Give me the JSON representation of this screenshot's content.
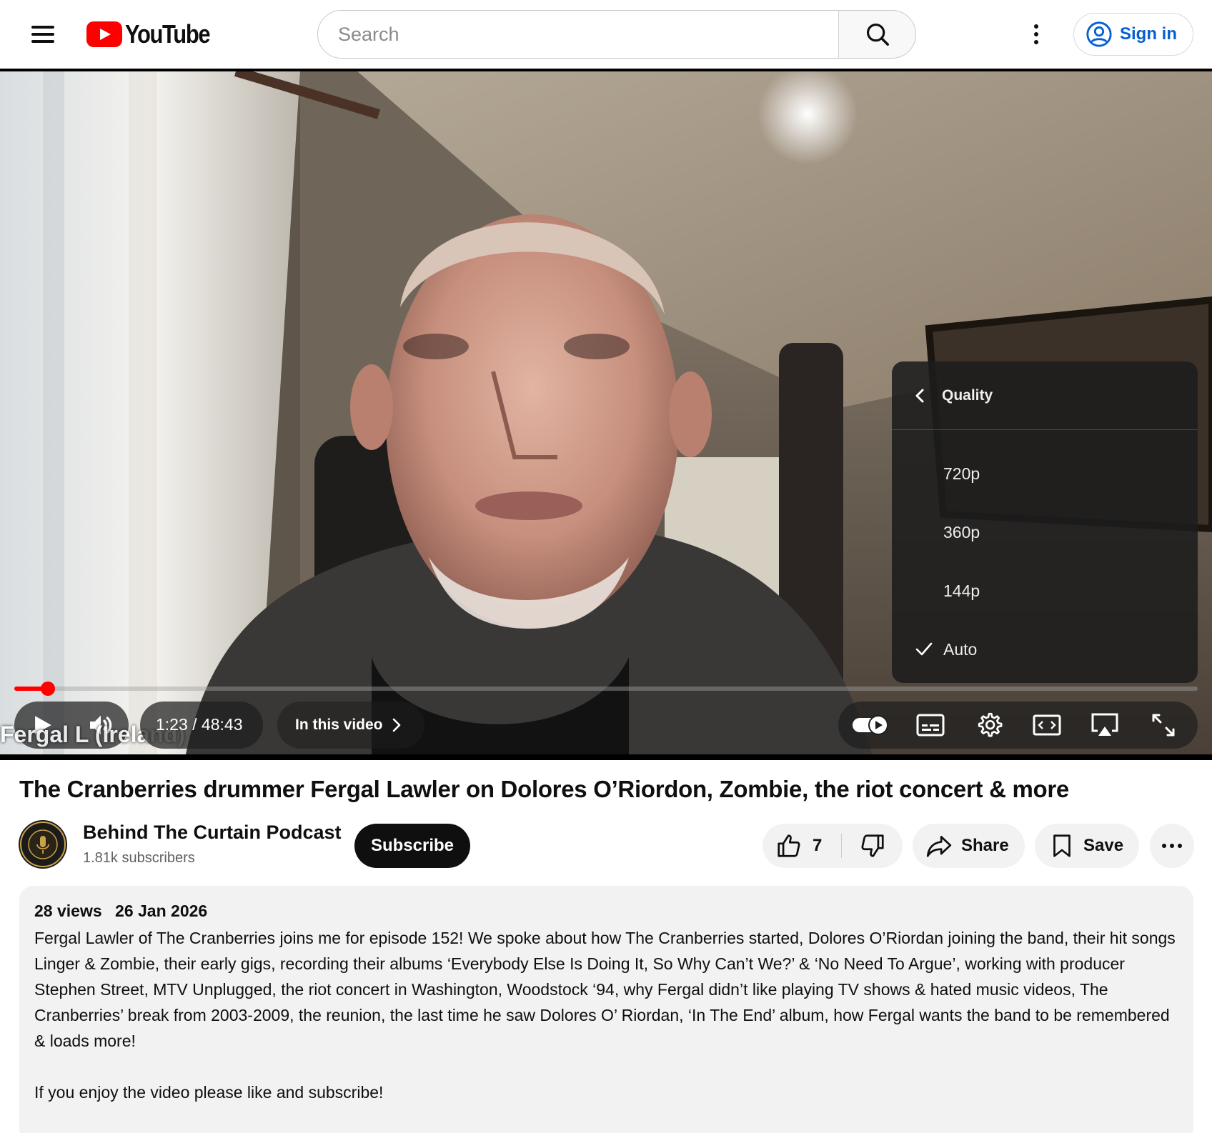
{
  "header": {
    "logo_text": "YouTube",
    "search_placeholder": "Search",
    "sign_in_label": "Sign in"
  },
  "player": {
    "name_overlay": "Fergal L (Ireland)",
    "current_time": "1:23",
    "duration": "48:43",
    "time_display": "1:23 / 48:43",
    "chapters_label": "In this video",
    "progress_fraction": 0.0284,
    "quality_menu": {
      "title": "Quality",
      "options": [
        {
          "label": "720p",
          "selected": false
        },
        {
          "label": "360p",
          "selected": false
        },
        {
          "label": "144p",
          "selected": false
        },
        {
          "label": "Auto",
          "selected": true
        }
      ]
    },
    "controls": [
      "play-icon",
      "volume-icon",
      "autoplay-toggle-icon",
      "subtitles-icon",
      "settings-icon",
      "miniplayer-icon",
      "airplay-icon",
      "fullscreen-icon"
    ]
  },
  "video": {
    "title": "The Cranberries drummer Fergal Lawler on Dolores O’Riordon, Zombie, the riot concert & more"
  },
  "channel": {
    "name": "Behind The Curtain Podcast",
    "subscribers": "1.81k subscribers",
    "avatar_text": "BEHIND THE CURTAIN PODCAST",
    "subscribe_label": "Subscribe"
  },
  "actions": {
    "like_count": "7",
    "share_label": "Share",
    "save_label": "Save"
  },
  "description": {
    "views": "28 views",
    "date": "26 Jan 2026",
    "body": "Fergal Lawler of The Cranberries joins me for episode 152! We spoke about how The Cranberries started, Dolores O’Riordan joining the band, their hit songs Linger & Zombie, their early gigs, recording their albums ‘Everybody Else Is Doing It, So Why Can’t We?’ & ‘No Need To Argue’, working with producer Stephen Street, MTV Unplugged, the riot concert in Washington, Woodstock ‘94, why Fergal didn’t like playing TV shows & hated music videos, The Cranberries’ break from 2003-2009, the reunion, the last time he saw Dolores O’ Riordan, ‘In The End’ album, how Fergal wants the band to be remembered & loads more!",
    "body2": "If you enjoy the video please like and subscribe!"
  },
  "colors": {
    "brand_red": "#ff0000",
    "link_blue": "#065fd4",
    "progress_red": "#ff0000",
    "text": "#0f0f0f",
    "secondary_text": "#606060",
    "chip_bg": "#f2f2f2"
  }
}
